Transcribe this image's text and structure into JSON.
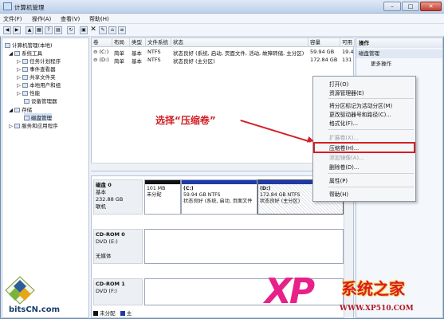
{
  "window": {
    "title": "计算机管理",
    "minimize": "–",
    "maximize": "□",
    "close": "✕"
  },
  "menubar": [
    "文件(F)",
    "操作(A)",
    "查看(V)",
    "帮助(H)"
  ],
  "tree": {
    "root": "计算机管理(本地)",
    "items": [
      {
        "label": "系统工具",
        "level": 1
      },
      {
        "label": "任务计划程序",
        "level": 2
      },
      {
        "label": "事件查看器",
        "level": 2
      },
      {
        "label": "共享文件夹",
        "level": 2
      },
      {
        "label": "本地用户和组",
        "level": 2
      },
      {
        "label": "性能",
        "level": 2
      },
      {
        "label": "设备管理器",
        "level": 2
      },
      {
        "label": "存储",
        "level": 1
      },
      {
        "label": "磁盘管理",
        "level": 2
      },
      {
        "label": "服务和应用程序",
        "level": 1
      }
    ]
  },
  "volumes": {
    "columns": [
      "卷",
      "布局",
      "类型",
      "文件系统",
      "状态",
      "容量",
      "可用"
    ],
    "rows": [
      [
        "(C:)",
        "简单",
        "基本",
        "NTFS",
        "状态良好 (系统, 启动, 页面文件, 活动, 故障转储, 主分区)",
        "59.94 GB",
        "19.4"
      ],
      [
        "(D:)",
        "简单",
        "基本",
        "NTFS",
        "状态良好 (主分区)",
        "172.84 GB",
        "131"
      ]
    ]
  },
  "disks": [
    {
      "name": "磁盘 0",
      "type": "基本",
      "size": "232.88 GB",
      "status": "联机",
      "partitions": [
        {
          "label": "",
          "size": "101 MB",
          "state": "未分配"
        },
        {
          "label": "(C:)",
          "size": "59.94 GB NTFS",
          "state": "状态良好 (系统, 启动, 页面文件"
        },
        {
          "label": "(D:)",
          "size": "172.84 GB NTFS",
          "state": "状态良好 (主分区)"
        }
      ]
    },
    {
      "name": "CD-ROM 0",
      "type": "DVD (E:)",
      "size": "",
      "status": "无媒体",
      "partitions": []
    },
    {
      "name": "CD-ROM 1",
      "type": "DVD (F:)",
      "size": "",
      "status": "",
      "partitions": []
    }
  ],
  "legend": {
    "unallocated": "未分配",
    "primary": "主"
  },
  "actions": {
    "header": "操作",
    "section": "磁盘管理",
    "more": "更多操作"
  },
  "context_menu": {
    "items": [
      {
        "label": "打开(O)",
        "disabled": false
      },
      {
        "label": "资源管理器(E)",
        "disabled": false
      },
      {
        "label": "将分区标记为活动分区(M)",
        "disabled": false
      },
      {
        "label": "更改驱动器号和路径(C)...",
        "disabled": false
      },
      {
        "label": "格式化(F)...",
        "disabled": false
      },
      {
        "label": "扩展卷(X)...",
        "disabled": true
      },
      {
        "label": "压缩卷(H)...",
        "disabled": false
      },
      {
        "label": "添加镜像(A)...",
        "disabled": true
      },
      {
        "label": "删除卷(D)...",
        "disabled": false
      },
      {
        "label": "属性(P)",
        "disabled": false
      },
      {
        "label": "帮助(H)",
        "disabled": false
      }
    ]
  },
  "annotation": {
    "callout": "选择“压缩卷”"
  },
  "watermarks": {
    "left": "bitsCN.com",
    "xp": "XP",
    "brand": "系统之家",
    "url": "WWW.XP510.COM"
  },
  "colors": {
    "accent": "#d31f25",
    "primary_bar": "#1e3aa8",
    "unalloc_bar": "#111111",
    "xp": "#e8208a"
  }
}
